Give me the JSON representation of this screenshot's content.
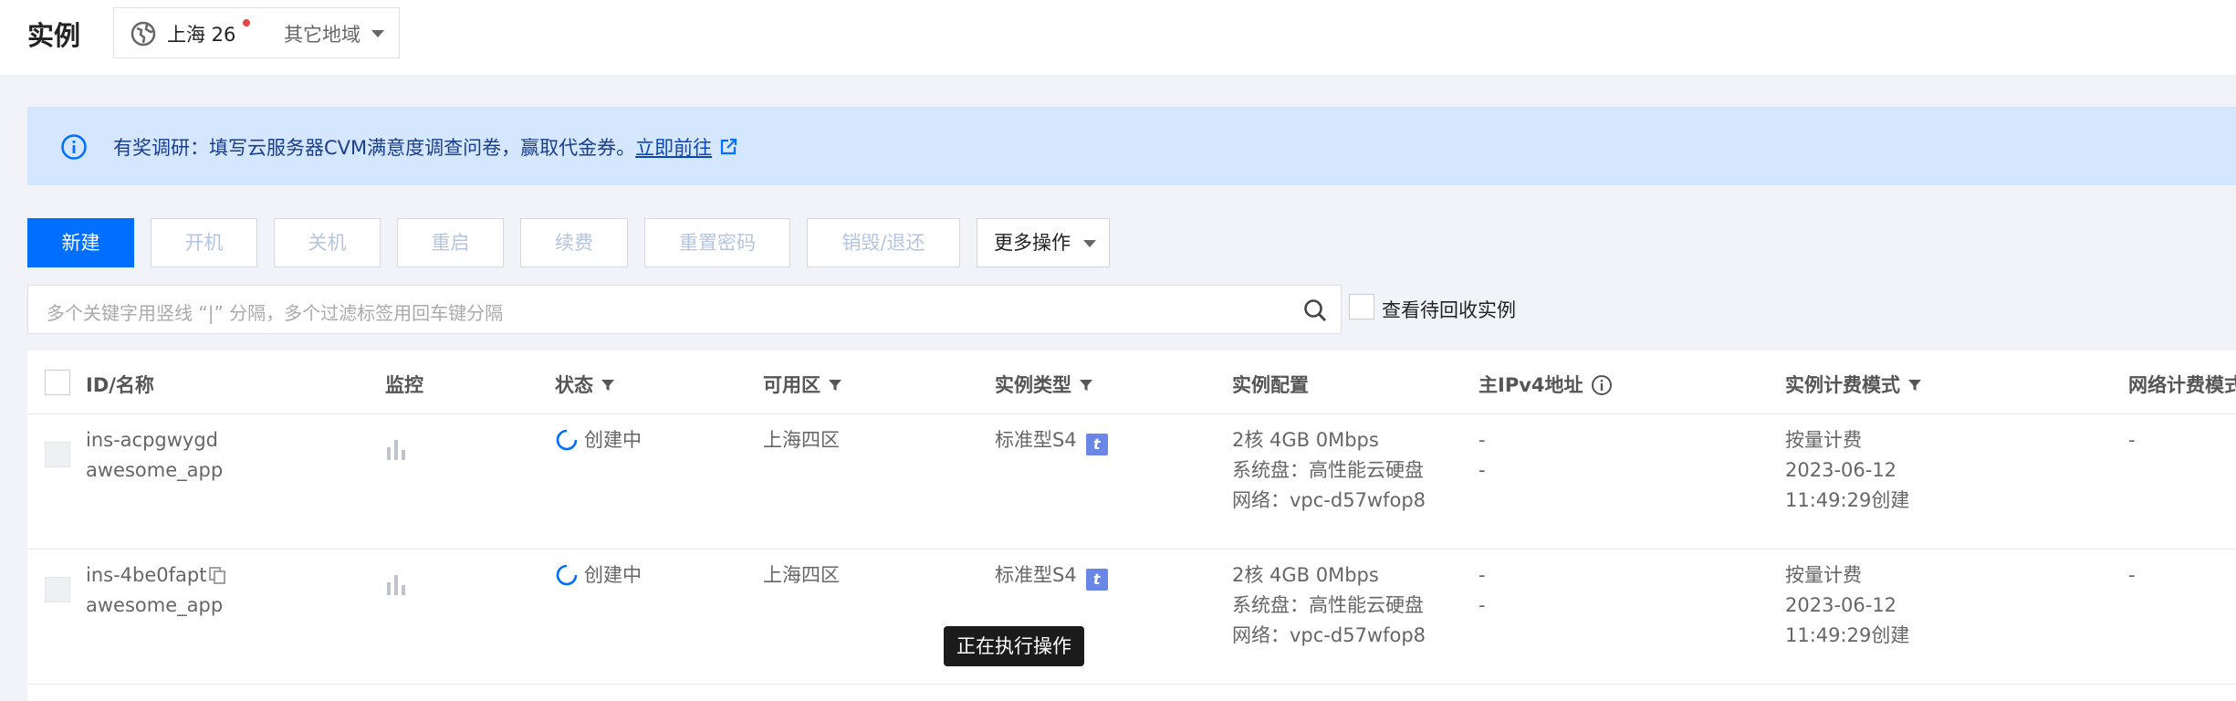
{
  "header": {
    "title": "实例",
    "region": "上海 26",
    "other_region": "其它地域"
  },
  "notice": {
    "text": "有奖调研：填写云服务器CVM满意度调查问卷，赢取代金券。",
    "link": "立即前往"
  },
  "toolbar": {
    "new": "新建",
    "start": "开机",
    "shutdown": "关机",
    "restart": "重启",
    "renew": "续费",
    "reset_password": "重置密码",
    "destroy": "销毁/退还",
    "more": "更多操作"
  },
  "search": {
    "placeholder": "多个关键字用竖线 “|” 分隔，多个过滤标签用回车键分隔",
    "recycle_label": "查看待回收实例"
  },
  "table": {
    "headers": {
      "id_name": "ID/名称",
      "monitor": "监控",
      "status": "状态",
      "zone": "可用区",
      "instance_type": "实例类型",
      "config": "实例配置",
      "ipv4": "主IPv4地址",
      "billing": "实例计费模式",
      "network_billing": "网络计费模式"
    },
    "rows": [
      {
        "id": "ins-acpgwygd",
        "name": "awesome_app",
        "status": "创建中",
        "zone": "上海四区",
        "type": "标准型S4",
        "type_badge": "t",
        "config_1": "2核 4GB 0Mbps",
        "config_2": "系统盘：高性能云硬盘",
        "config_3": "网络：vpc-d57wfop8",
        "ip_1": "-",
        "ip_2": "-",
        "billing_1": "按量计费",
        "billing_2": "2023-06-12",
        "billing_3": "11:49:29创建",
        "net_billing": "-"
      },
      {
        "id": "ins-4be0fapt",
        "name": "awesome_app",
        "status": "创建中",
        "zone": "上海四区",
        "type": "标准型S4",
        "type_badge": "t",
        "config_1": "2核 4GB 0Mbps",
        "config_2": "系统盘：高性能云硬盘",
        "config_3": "网络：vpc-d57wfop8",
        "ip_1": "-",
        "ip_2": "-",
        "billing_1": "按量计费",
        "billing_2": "2023-06-12",
        "billing_3": "11:49:29创建",
        "net_billing": "-"
      }
    ]
  },
  "tooltip": "正在执行操作",
  "colors": {
    "primary": "#006eff",
    "notice_bg": "#d5e7ff",
    "alert_dot": "#e54545",
    "page_bg": "#f2f3f8"
  }
}
